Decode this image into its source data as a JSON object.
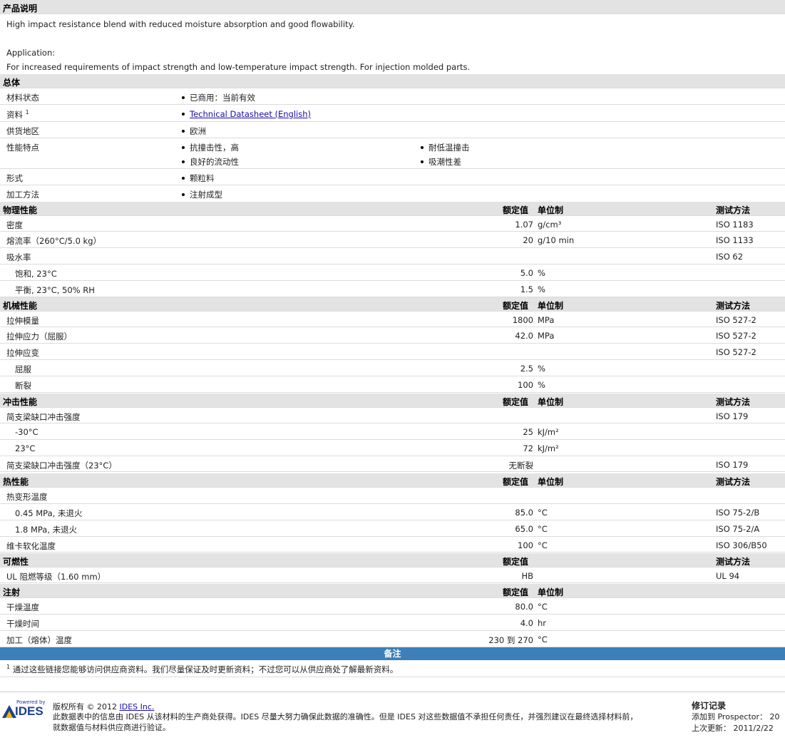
{
  "description": {
    "title": "产品说明",
    "line1": "High impact resistance blend with reduced moisture absorption and good flowability.",
    "app_label": "Application:",
    "app_text": "For increased requirements of impact strength and low-temperature impact strength. For injection molded parts."
  },
  "general": {
    "title": "总体",
    "status_label": "材料状态",
    "status_value": "已商用：当前有效",
    "doc_label": "资料",
    "doc_sup": "1",
    "doc_link": "Technical Datasheet (English)",
    "region_label": "供货地区",
    "region_value": "欧洲",
    "features_label": "性能特点",
    "features": [
      "抗撞击性，高",
      "耐低温撞击",
      "良好的流动性",
      "吸潮性差"
    ],
    "form_label": "形式",
    "form_value": "颗粒料",
    "process_label": "加工方法",
    "process_value": "注射成型"
  },
  "headers": {
    "nominal": "额定值",
    "unit": "单位制",
    "method": "测试方法"
  },
  "physical": {
    "title": "物理性能",
    "rows": [
      {
        "name": "密度",
        "value": "1.07",
        "unit": "g/cm³",
        "method": "ISO 1183"
      },
      {
        "name": "熔流率（260°C/5.0 kg）",
        "value": "20",
        "unit": "g/10 min",
        "method": "ISO 1133"
      },
      {
        "name": "吸水率",
        "value": "",
        "unit": "",
        "method": "ISO 62"
      },
      {
        "name": "饱和, 23°C",
        "value": "5.0",
        "unit": "%",
        "method": ""
      },
      {
        "name": "平衡, 23°C, 50% RH",
        "value": "1.5",
        "unit": "%",
        "method": ""
      }
    ]
  },
  "mechanical": {
    "title": "机械性能",
    "rows": [
      {
        "name": "拉伸模量",
        "value": "1800",
        "unit": "MPa",
        "method": "ISO 527-2"
      },
      {
        "name": "拉伸应力（屈服）",
        "value": "42.0",
        "unit": "MPa",
        "method": "ISO 527-2"
      },
      {
        "name": "拉伸应变",
        "value": "",
        "unit": "",
        "method": "ISO 527-2"
      },
      {
        "name": "屈服",
        "value": "2.5",
        "unit": "%",
        "method": ""
      },
      {
        "name": "断裂",
        "value": "100",
        "unit": "%",
        "method": ""
      }
    ]
  },
  "impact": {
    "title": "冲击性能",
    "rows": [
      {
        "name": "简支梁缺口冲击强度",
        "value": "",
        "unit": "",
        "method": "ISO 179"
      },
      {
        "name": "-30°C",
        "value": "25",
        "unit": "kJ/m²",
        "method": ""
      },
      {
        "name": "23°C",
        "value": "72",
        "unit": "kJ/m²",
        "method": ""
      },
      {
        "name": "简支梁缺口冲击强度（23°C）",
        "value": "无断裂",
        "unit": "",
        "method": "ISO 179"
      }
    ]
  },
  "thermal": {
    "title": "热性能",
    "rows": [
      {
        "name": "热变形温度",
        "value": "",
        "unit": "",
        "method": ""
      },
      {
        "name": "0.45 MPa, 未退火",
        "value": "85.0",
        "unit": "°C",
        "method": "ISO 75-2/B"
      },
      {
        "name": "1.8 MPa, 未退火",
        "value": "65.0",
        "unit": "°C",
        "method": "ISO 75-2/A"
      },
      {
        "name": "维卡软化温度",
        "value": "100",
        "unit": "°C",
        "method": "ISO 306/B50"
      }
    ]
  },
  "flammability": {
    "title": "可燃性",
    "rows": [
      {
        "name": "UL 阻燃等级（1.60 mm）",
        "value": "HB",
        "unit": "",
        "method": "UL 94"
      }
    ]
  },
  "injection": {
    "title": "注射",
    "rows": [
      {
        "name": "干燥温度",
        "value": "80.0",
        "unit": "°C",
        "method": ""
      },
      {
        "name": "干燥时间",
        "value": "4.0",
        "unit": "hr",
        "method": ""
      },
      {
        "name": "加工（熔体）温度",
        "value": "230 到  270",
        "unit": "°C",
        "method": ""
      }
    ]
  },
  "notes": {
    "title": "备注",
    "sup": "1",
    "text": "通过这些链接您能够访问供应商资料。我们尽量保证及时更新资料；不过您可以从供应商处了解最新资料。"
  },
  "footer": {
    "powered_by": "Powered by",
    "logo_text": "IDES",
    "copyright_prefix": "版权所有  © 2012",
    "copyright_link": "IDES Inc.",
    "disclaimer1": "此数据表中的信息由  IDES 从该材料的生产商处获得。IDES 尽量大努力确保此数据的准确性。但是  IDES 对这些数据值不承担任何责任，并强烈建议在最终选择材料前，",
    "disclaimer2": "就数据值与材料供应商进行验证。",
    "revision_title": "修订记录",
    "added_label": "添加到  Prospector：",
    "added_value": "20",
    "updated_label": "上次更新：",
    "updated_value": "2011/2/22"
  },
  "colors": {
    "section_bg": "#e3e3e3",
    "notes_bar": "#3c7fba",
    "link": "#1a0dab"
  }
}
